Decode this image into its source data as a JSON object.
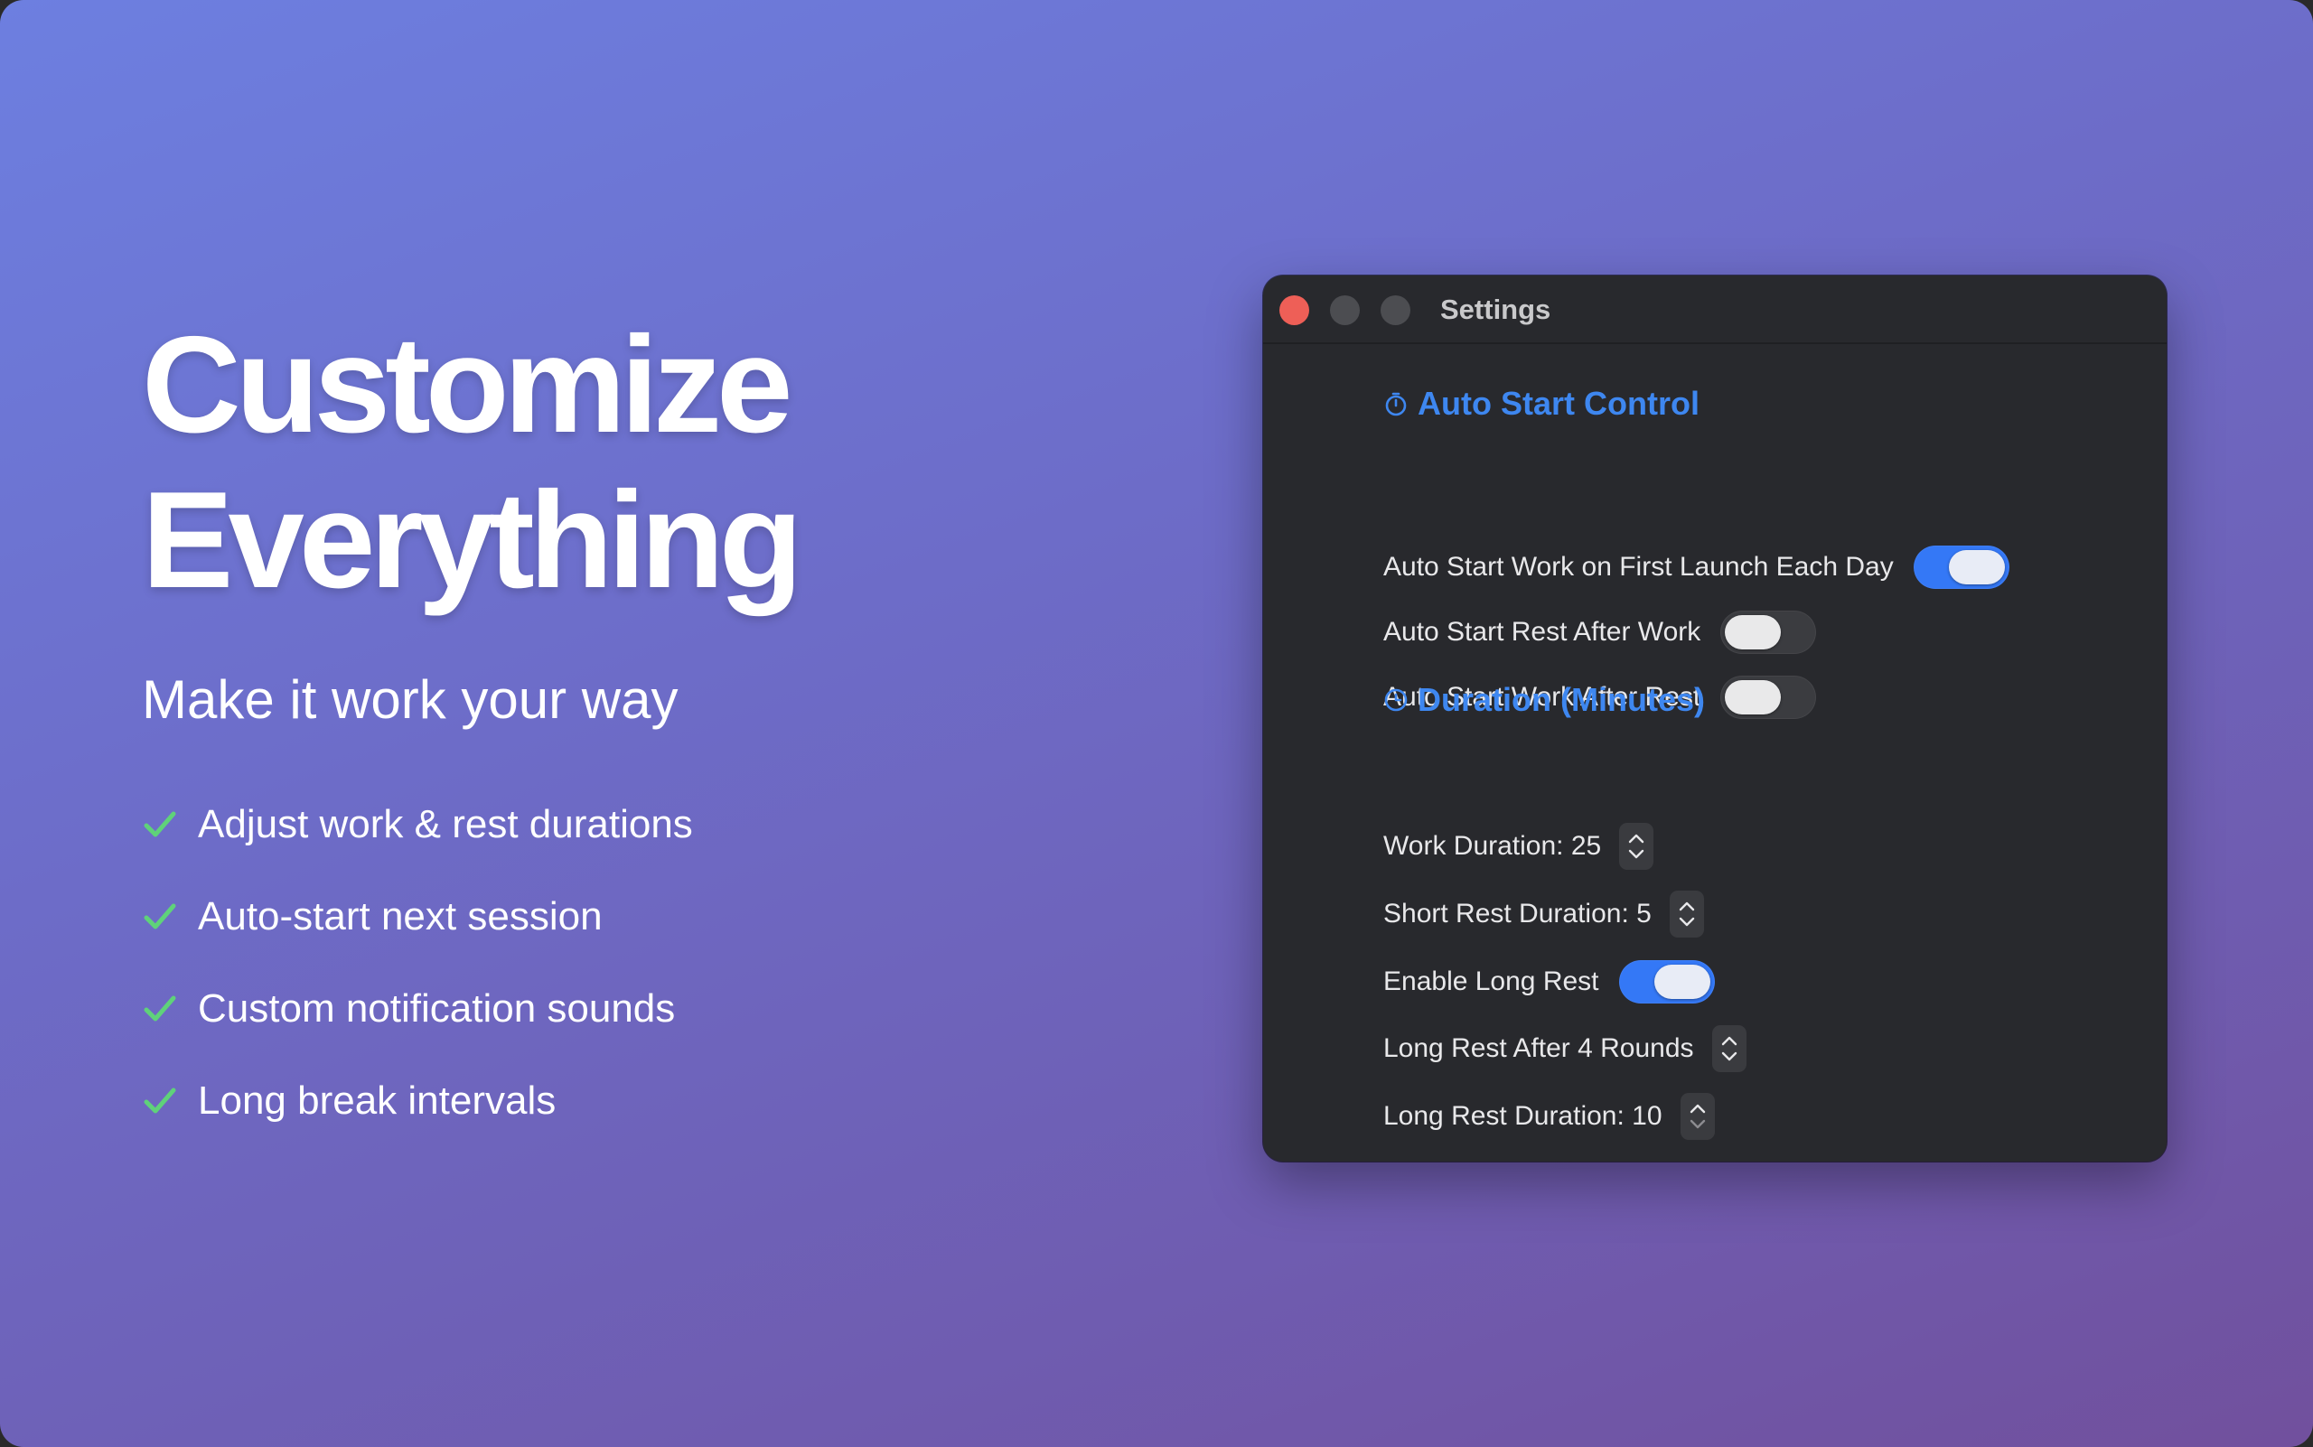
{
  "hero": {
    "headline_line1": "Customize",
    "headline_line2": "Everything",
    "subtitle": "Make it work your way",
    "features": [
      "Adjust work & rest durations",
      "Auto-start next session",
      "Custom notification sounds",
      "Long break intervals"
    ]
  },
  "window": {
    "title": "Settings",
    "sections": {
      "auto_start": {
        "title": "Auto Start Control",
        "icon": "stopwatch-icon",
        "items": [
          {
            "label": "Auto Start Work on First Launch Each Day",
            "on": true
          },
          {
            "label": "Auto Start Rest After Work",
            "on": false
          },
          {
            "label": "Auto Start Work After Rest",
            "on": false
          }
        ]
      },
      "duration": {
        "title": "Duration (Minutes)",
        "icon": "clock-icon",
        "work_duration": "Work Duration: 25",
        "short_rest_duration": "Short Rest Duration: 5",
        "enable_long_rest": {
          "label": "Enable Long Rest",
          "on": true
        },
        "long_rest_after": "Long Rest After 4 Rounds",
        "long_rest_duration": "Long Rest Duration: 10"
      }
    }
  },
  "colors": {
    "accent": "#3478f6",
    "section_title": "#3e87f0",
    "check": "#5fd27a",
    "window_bg": "#28292d"
  }
}
